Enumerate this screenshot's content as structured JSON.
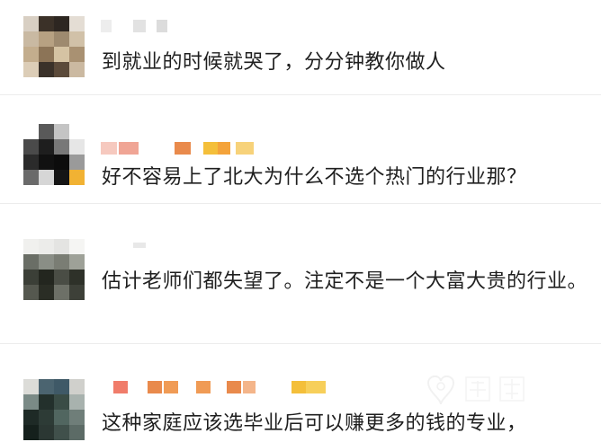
{
  "comments": [
    {
      "text": "到就业的时候就哭了，分分钟教你做人"
    },
    {
      "text": "好不容易上了北大为什么不选个热门的行业那？"
    },
    {
      "text": "估计老师们都失望了。注定不是一个大富大贵的行业。"
    },
    {
      "text": "这种家庭应该选毕业后可以赚更多的钱的专业，"
    }
  ],
  "colors": {
    "text": "#1f1f1f",
    "divider": "#ececec",
    "name_orange": "#e98a4c",
    "name_yellow": "#f4bf3a",
    "name_red": "#f07c6a"
  }
}
